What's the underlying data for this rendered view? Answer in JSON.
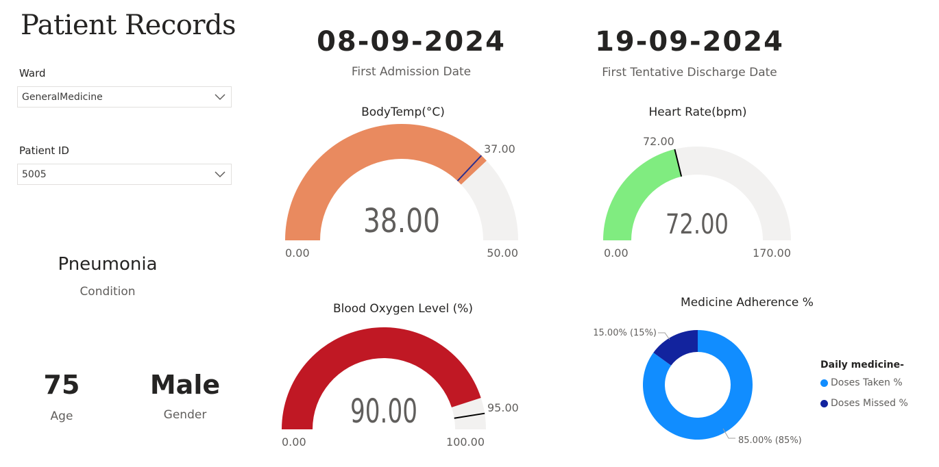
{
  "header": {
    "title": "Patient Records"
  },
  "filters": {
    "ward": {
      "label": "Ward",
      "value": "GeneralMedicine"
    },
    "patient_id": {
      "label": "Patient ID",
      "value": "5005"
    }
  },
  "cards": {
    "admission": {
      "value": "08-09-2024",
      "label": "First Admission Date"
    },
    "discharge": {
      "value": "19-09-2024",
      "label": "First Tentative Discharge Date"
    },
    "condition": {
      "value": "Pneumonia",
      "label": "Condition"
    },
    "age": {
      "value": "75",
      "label": "Age"
    },
    "gender": {
      "value": "Male",
      "label": "Gender"
    }
  },
  "gauges": {
    "body_temp": {
      "title": "BodyTemp(°C)",
      "value": 38.0,
      "target": 37.0,
      "min": 0.0,
      "max": 50.0,
      "value_label": "38.00",
      "target_label": "37.00",
      "min_label": "0.00",
      "max_label": "50.00",
      "fill_color": "#e98a5f",
      "track_color": "#f2f1f0",
      "target_color": "#2b2f8f"
    },
    "heart_rate": {
      "title": "Heart Rate(bpm)",
      "value": 72.0,
      "target": 72.0,
      "min": 0.0,
      "max": 170.0,
      "value_label": "72.00",
      "target_label": "72.00",
      "min_label": "0.00",
      "max_label": "170.00",
      "fill_color": "#80ec80",
      "track_color": "#f2f1f0",
      "target_color": "#000000"
    },
    "blood_oxygen": {
      "title": "Blood Oxygen Level (%)",
      "value": 90.0,
      "target": 95.0,
      "min": 0.0,
      "max": 100.0,
      "value_label": "90.00",
      "target_label": "95.00",
      "min_label": "0.00",
      "max_label": "100.00",
      "fill_color": "#c01824",
      "track_color": "#f2f1f0",
      "target_color": "#000000"
    }
  },
  "chart_data": {
    "type": "pie",
    "title": "Medicine Adherence %",
    "legend_title": "Daily medicine-",
    "legend_position": "right",
    "series": [
      {
        "name": "Doses Taken %",
        "value": 85,
        "label": "85.00% (85%)",
        "color": "#118dff"
      },
      {
        "name": "Doses Missed %",
        "value": 15,
        "label": "15.00% (15%)",
        "color": "#12239e"
      }
    ]
  }
}
